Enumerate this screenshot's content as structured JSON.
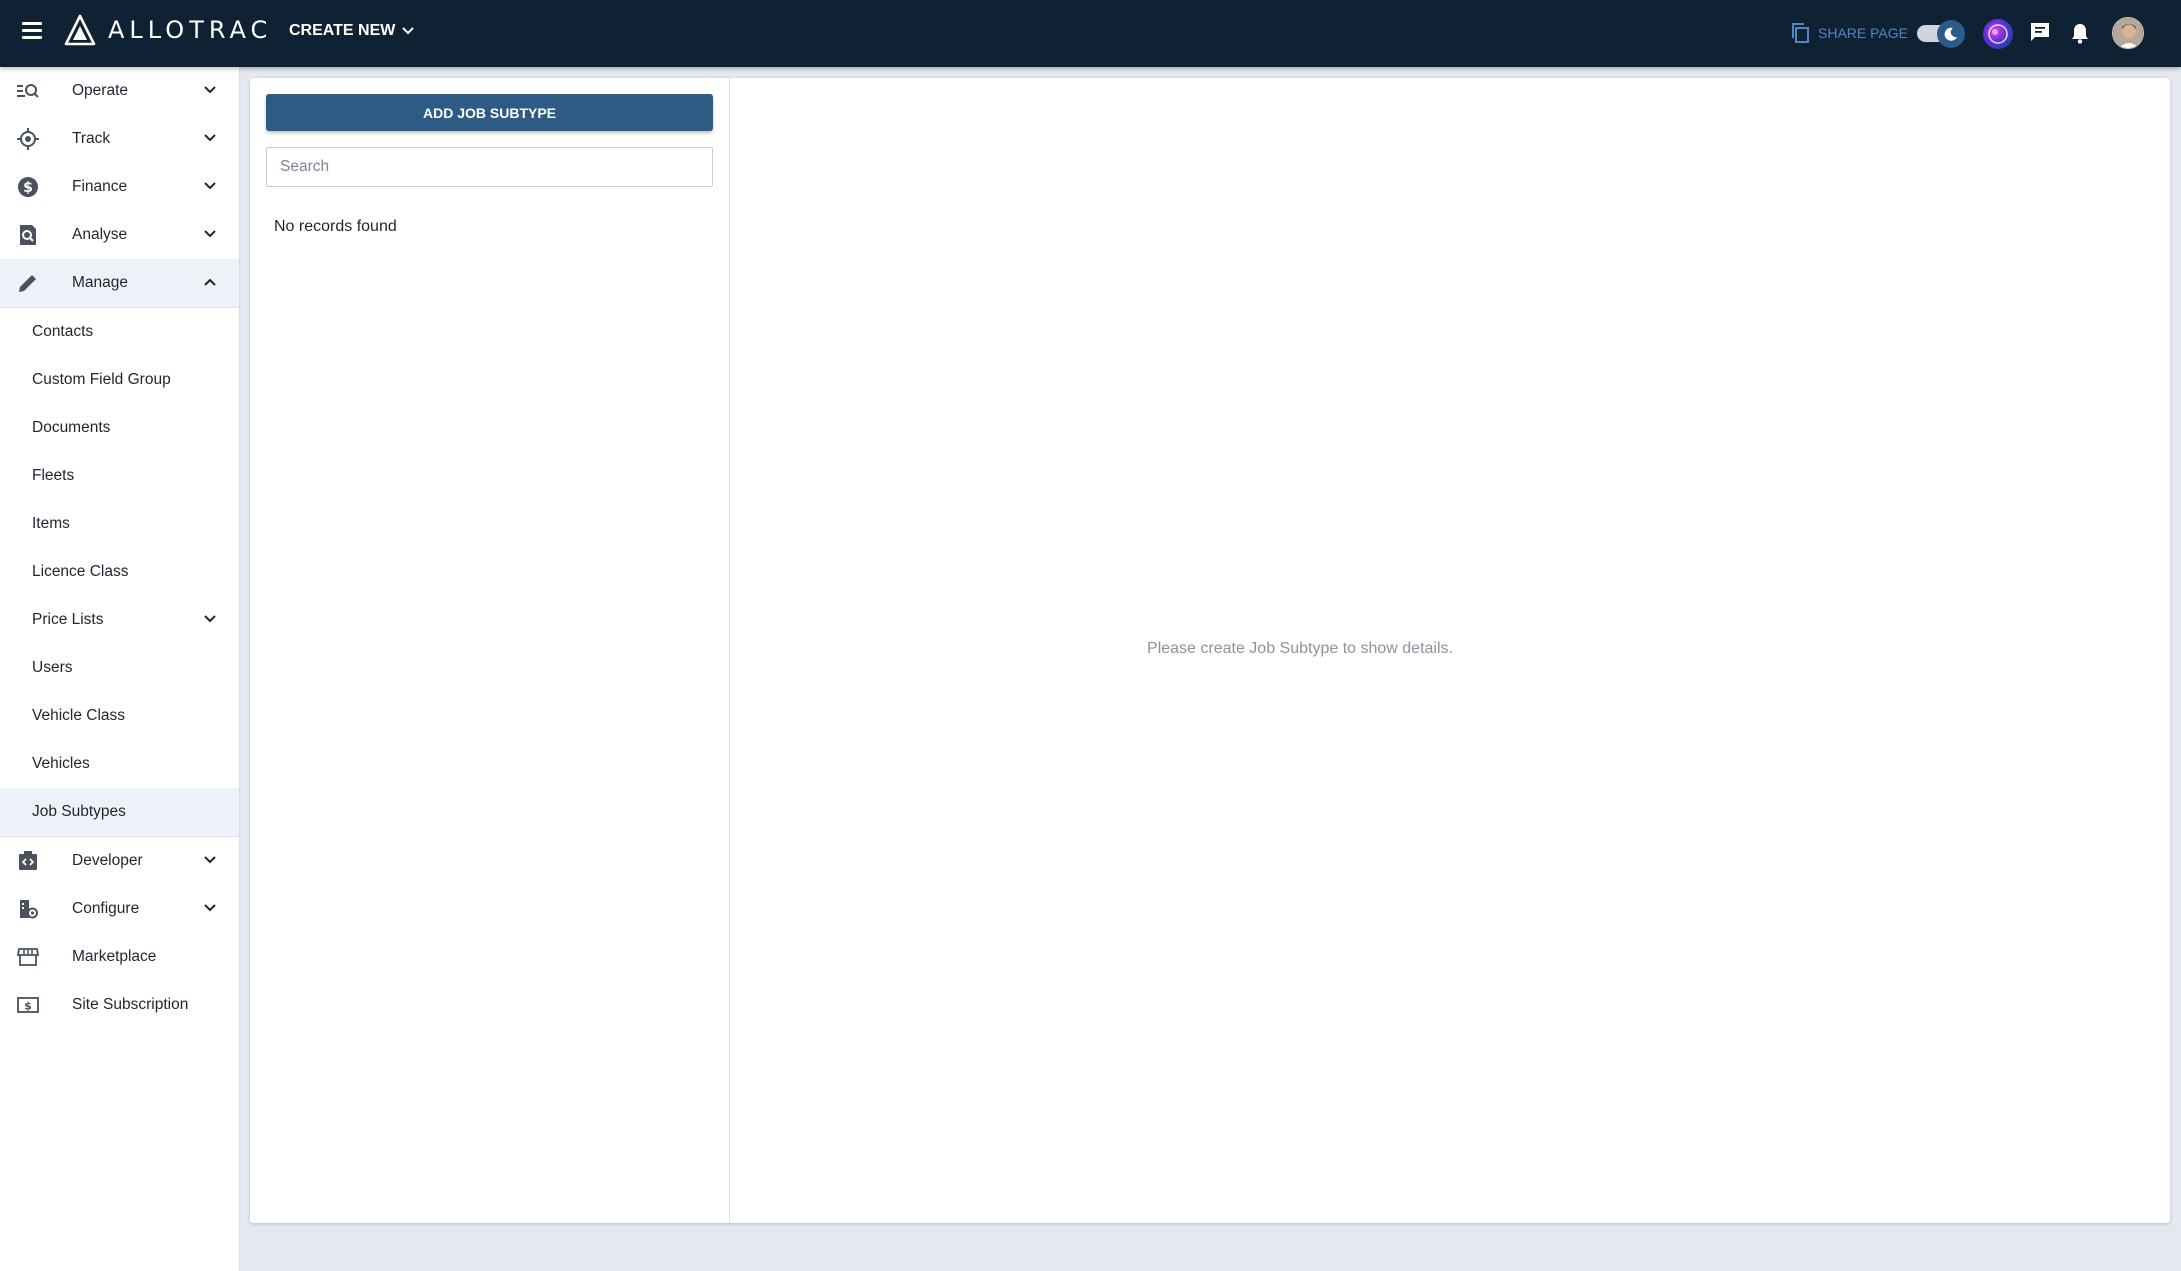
{
  "app": {
    "brand": "ALLOTRAC",
    "create_new_label": "CREATE NEW",
    "share_page_label": "SHARE PAGE"
  },
  "topbar_icons": [
    "menu-icon",
    "allotrac-logo-icon",
    "copy-icon",
    "theme-toggle-moon-icon",
    "ai-assistant-icon",
    "chat-icon",
    "bell-icon",
    "user-avatar"
  ],
  "sidebar": {
    "items": [
      {
        "label": "Operate",
        "icon": "operate-search-icon",
        "expandable": true,
        "open": false
      },
      {
        "label": "Track",
        "icon": "track-target-icon",
        "expandable": true,
        "open": false
      },
      {
        "label": "Finance",
        "icon": "dollar-icon",
        "expandable": true,
        "open": false
      },
      {
        "label": "Analyse",
        "icon": "analyse-doc-search-icon",
        "expandable": true,
        "open": false
      },
      {
        "label": "Manage",
        "icon": "pencil-icon",
        "expandable": true,
        "open": true
      },
      {
        "label": "Developer",
        "icon": "developer-code-icon",
        "expandable": true,
        "open": false
      },
      {
        "label": "Configure",
        "icon": "configure-gear-icon",
        "expandable": true,
        "open": false
      },
      {
        "label": "Marketplace",
        "icon": "store-icon",
        "expandable": false,
        "open": false
      },
      {
        "label": "Site Subscription",
        "icon": "subscription-dollar-icon",
        "expandable": false,
        "open": false
      }
    ],
    "manage_subitems": [
      {
        "label": "Contacts"
      },
      {
        "label": "Custom Field Group"
      },
      {
        "label": "Documents"
      },
      {
        "label": "Fleets"
      },
      {
        "label": "Items"
      },
      {
        "label": "Licence Class"
      },
      {
        "label": "Price Lists",
        "expandable": true
      },
      {
        "label": "Users"
      },
      {
        "label": "Vehicle Class"
      },
      {
        "label": "Vehicles"
      },
      {
        "label": "Job Subtypes",
        "active": true
      }
    ]
  },
  "main": {
    "add_button_label": "ADD JOB SUBTYPE",
    "search": {
      "placeholder": "Search",
      "value": ""
    },
    "empty_text": "No records found",
    "detail_message": "Please create Job Subtype to show details."
  },
  "colors": {
    "topbar_bg": "#0e2233",
    "primary_button": "#2e5a86",
    "share_link": "#4d88c6",
    "active_bg": "#eef2f8",
    "page_bg": "#e3e8f1"
  }
}
